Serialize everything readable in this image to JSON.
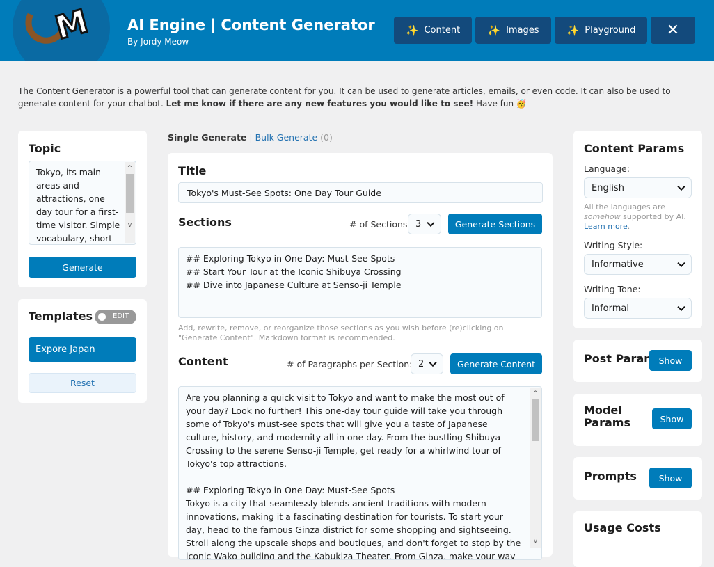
{
  "header": {
    "title": "AI Engine | Content Generator",
    "subtitle": "By Jordy Meow",
    "logo_text": "M",
    "nav": [
      {
        "label": "Content",
        "icon": "sparkles-icon"
      },
      {
        "label": "Images",
        "icon": "sparkles-icon"
      },
      {
        "label": "Playground",
        "icon": "sparkles-icon"
      },
      {
        "label": "",
        "icon": "tools-icon"
      }
    ]
  },
  "intro": {
    "text": "The Content Generator is a powerful tool that can generate content for you. It can be used to generate articles, emails, or even code. It can also be used to generate content for your chatbot. ",
    "bold": "Let me know if there are any new features you would like to see!",
    "end": " Have fun",
    "emoji": "🥳"
  },
  "topic": {
    "title": "Topic",
    "value": "Tokyo, its main areas and attractions, one day tour for a first-time visitor. Simple vocabulary, short",
    "generate": "Generate"
  },
  "templates": {
    "title": "Templates",
    "toggle": "EDIT",
    "items": [
      "Expore Japan"
    ],
    "reset": "Reset"
  },
  "tabs": {
    "single": "Single Generate",
    "sep": "|",
    "bulk": "Bulk Generate",
    "bulk_count": "(0)"
  },
  "main": {
    "title_label": "Title",
    "title_value": "Tokyo's Must-See Spots: One Day Tour Guide",
    "sections_label": "Sections",
    "num_sections_label": "# of Sections:",
    "num_sections": "3",
    "gen_sections": "Generate Sections",
    "sections_value": "## Exploring Tokyo in One Day: Must-See Spots\n## Start Your Tour at the Iconic Shibuya Crossing\n## Dive into Japanese Culture at Senso-ji Temple",
    "sections_hint": "Add, rewrite, remove, or reorganize those sections as you wish before (re)clicking on \"Generate Content\". Markdown format is recommended.",
    "content_label": "Content",
    "num_par_label": "# of Paragraphs per Section:",
    "num_par": "2",
    "gen_content": "Generate Content",
    "content_value": "Are you planning a quick visit to Tokyo and want to make the most out of your day? Look no further! This one-day tour guide will take you through some of Tokyo's must-see spots that will give you a taste of Japanese culture, history, and modernity all in one day. From the bustling Shibuya Crossing to the serene Senso-ji Temple, get ready for a whirlwind tour of Tokyo's top attractions.\n\n## Exploring Tokyo in One Day: Must-See Spots\nTokyo is a city that seamlessly blends ancient traditions with modern innovations, making it a fascinating destination for tourists. To start your day, head to the famous Ginza district for some shopping and sightseeing. Stroll along the upscale shops and boutiques, and don't forget to stop by the iconic Wako building and the Kabukiza Theater. From Ginza, make your way to the historic Imperial Palace,"
  },
  "params": {
    "title": "Content Params",
    "language_label": "Language:",
    "language": "English",
    "lang_hint1": "All the languages are ",
    "lang_hint_em": "somehow",
    "lang_hint2": " supported by AI. ",
    "learn_more": "Learn more",
    "style_label": "Writing Style:",
    "style": "Informative",
    "tone_label": "Writing Tone:",
    "tone": "Informal"
  },
  "post_params": {
    "title": "Post Params",
    "show": "Show"
  },
  "model_params": {
    "title": "Model Params",
    "show": "Show"
  },
  "prompts": {
    "title": "Prompts",
    "show": "Show"
  },
  "usage": {
    "title": "Usage Costs"
  },
  "colors": {
    "header": "#007cba",
    "nav_button": "#134a7c",
    "primary": "#007cba",
    "background": "#f0f0f1"
  }
}
